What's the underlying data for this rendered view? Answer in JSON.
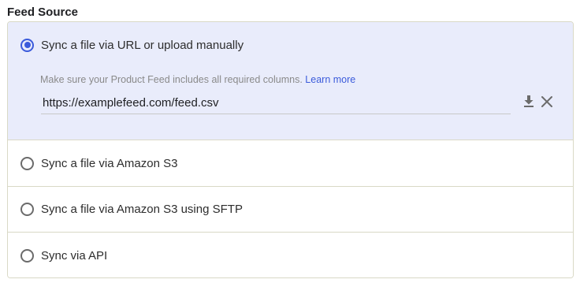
{
  "section": {
    "title": "Feed Source"
  },
  "options": [
    {
      "label": "Sync a file via URL or upload manually",
      "selected": true
    },
    {
      "label": "Sync a file via Amazon S3",
      "selected": false
    },
    {
      "label": "Sync a file via Amazon S3 using SFTP",
      "selected": false
    },
    {
      "label": "Sync via API",
      "selected": false
    }
  ],
  "url_panel": {
    "helper_text": "Make sure your Product Feed includes all required columns.",
    "learn_more": "Learn more",
    "url_value": "https://examplefeed.com/feed.csv",
    "download_icon": "download-icon",
    "close_icon": "close-icon"
  },
  "colors": {
    "accent": "#3b5bdb",
    "selected_bg": "#e9ecfb",
    "border": "#d9d9c6"
  }
}
